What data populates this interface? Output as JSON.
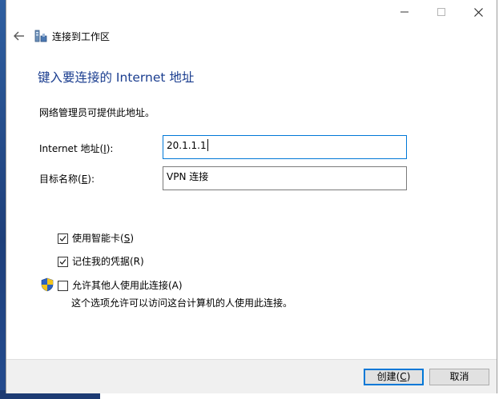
{
  "window": {
    "title": "连接到工作区"
  },
  "page": {
    "heading": "键入要连接的 Internet 地址",
    "description": "网络管理员可提供此地址。"
  },
  "fields": {
    "address": {
      "label_main": "Internet 地址(",
      "label_key": "I",
      "label_end": "):",
      "value": "20.1.1.1"
    },
    "destination": {
      "label_main": "目标名称(",
      "label_key": "E",
      "label_end": "):",
      "value": "VPN 连接"
    }
  },
  "options": {
    "smart_card": {
      "label_main": "使用智能卡(",
      "label_key": "S",
      "label_end": ")",
      "checked": true
    },
    "remember": {
      "label": "记住我的凭据(R)",
      "checked": true
    },
    "allow_others": {
      "label": "允许其他人使用此连接(A)",
      "checked": false
    },
    "allow_others_desc": "这个选项允许可以访问这台计算机的人使用此连接。"
  },
  "buttons": {
    "create_main": "创建(",
    "create_key": "C",
    "create_end": ")",
    "cancel": "取消"
  },
  "colors": {
    "heading": "#1a3d8f",
    "focus": "#0078d7",
    "footer_bg": "#f0f0f0"
  }
}
